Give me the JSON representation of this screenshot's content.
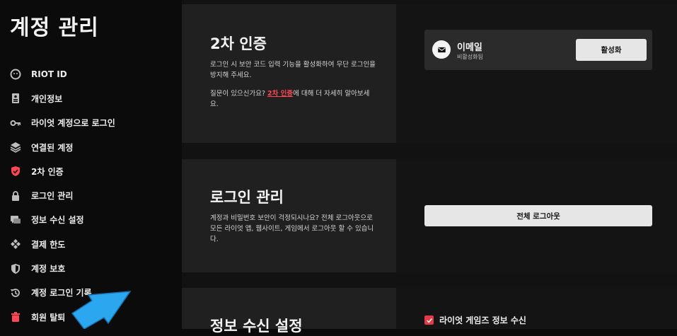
{
  "sidebar": {
    "title": "계정 관리",
    "items": [
      {
        "label": "RIOT ID"
      },
      {
        "label": "개인정보"
      },
      {
        "label": "라이엇 계정으로 로그인"
      },
      {
        "label": "연결된 계정"
      },
      {
        "label": "2차 인증"
      },
      {
        "label": "로그인 관리"
      },
      {
        "label": "정보 수신 설정"
      },
      {
        "label": "결제 한도"
      },
      {
        "label": "계정 보호"
      },
      {
        "label": "계정 로그인 기록"
      },
      {
        "label": "회원 탈퇴"
      }
    ]
  },
  "two_factor": {
    "title": "2차 인증",
    "desc1": "로그인 시 보안 코드 입력 기능을 활성화하여 무단 로그인을 방지해 주세요.",
    "desc2_prefix": "질문이 있으신가요? ",
    "desc2_link": "2차 인증",
    "desc2_suffix": "에 대해 더 자세히 알아보세요.",
    "email_title": "이메일",
    "email_status": "비활성화됨",
    "activate_label": "활성화"
  },
  "login_mgmt": {
    "title": "로그인 관리",
    "desc": "계정과 비밀번호 보안이 걱정되시나요? 전체 로그아웃으로 모든 라이엇 앱, 웹사이트, 게임에서 로그아웃 할 수 있습니다.",
    "logout_all_label": "전체 로그아웃"
  },
  "info_settings": {
    "title": "정보 수신 설정",
    "checkbox_label": "라이엇 게임즈 정보 수신",
    "checkbox_checked": true
  },
  "colors": {
    "accent_red": "#ff4655",
    "arrow_blue": "#2aa7ee"
  }
}
